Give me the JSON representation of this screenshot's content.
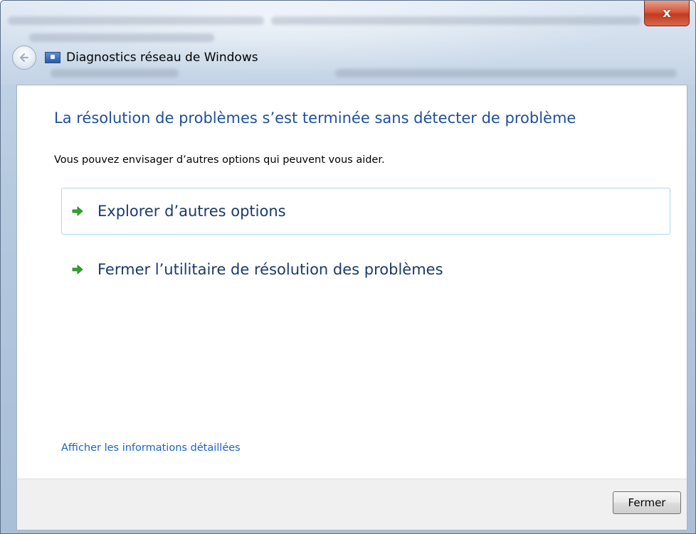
{
  "window": {
    "title": "Diagnostics réseau de Windows",
    "close_glyph": "x"
  },
  "content": {
    "heading": "La résolution de problèmes s’est terminée sans détecter de problème",
    "subtitle": "Vous pouvez envisager d’autres options qui peuvent vous aider.",
    "options": [
      {
        "label": "Explorer d’autres options",
        "icon": "green-arrow-icon"
      },
      {
        "label": "Fermer l’utilitaire de résolution des problèmes",
        "icon": "green-arrow-icon"
      }
    ],
    "details_link": "Afficher les informations détaillées"
  },
  "footer": {
    "close_button": "Fermer"
  },
  "colors": {
    "heading": "#1e4f9c",
    "link": "#1a63c9",
    "arrow": "#2fa62b"
  }
}
